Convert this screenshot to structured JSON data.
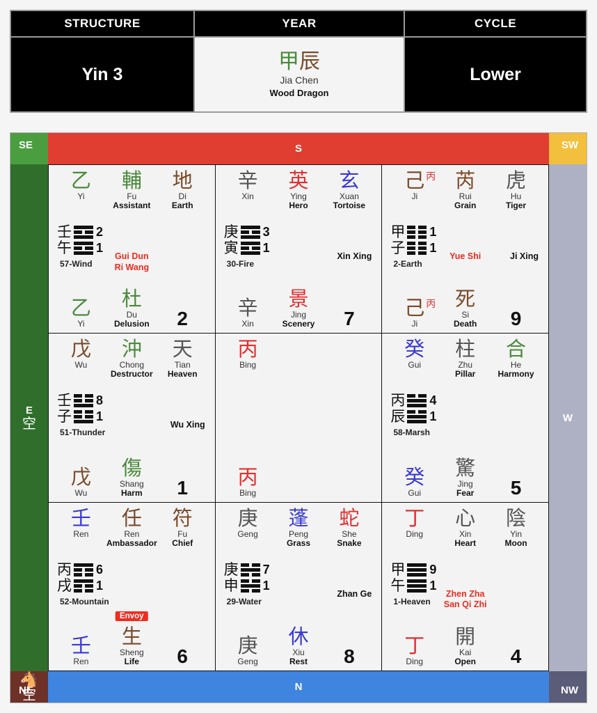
{
  "header": {
    "columns": [
      {
        "label": "STRUCTURE",
        "value": "Yin 3"
      },
      {
        "label": "YEAR",
        "value": ""
      },
      {
        "label": "CYCLE",
        "value": "Lower"
      }
    ],
    "structure_label": "STRUCTURE",
    "structure_value": "Yin 3",
    "year_label": "YEAR",
    "year_cn_1": "甲",
    "year_cn_2": "辰",
    "year_pinyin": "Jia Chen",
    "year_english": "Wood Dragon",
    "cycle_label": "CYCLE",
    "cycle_value": "Lower"
  },
  "directions": {
    "se": "SE",
    "s": "S",
    "sw": "SW",
    "e": "E",
    "w": "W",
    "ne": "NE",
    "n": "N",
    "nw": "NW",
    "e_void_cn": "空",
    "ne_void_cn": "空",
    "ne_horse_icon": "horse-icon"
  },
  "colors": {
    "se": "#4a9e3f",
    "s": "#e03e30",
    "sw": "#f2c03c",
    "e": "#2f6e2b",
    "w": "#aeb0c4",
    "ne": "#6e3128",
    "n": "#3f84de",
    "nw": "#5a5c78",
    "accent_red": "#ee2b20",
    "green": "#4a8a3c",
    "brown": "#7a4a2a",
    "blue": "#3a3ad0",
    "grey": "#555"
  },
  "palaces": [
    {
      "id": "se",
      "number": "2",
      "top": [
        {
          "cn": "乙",
          "sup": "",
          "romaji": "Yi",
          "meaning": "",
          "color": "c-green"
        },
        {
          "cn": "輔",
          "sup": "",
          "romaji": "Fu",
          "meaning": "Assistant",
          "color": "c-green"
        },
        {
          "cn": "地",
          "sup": "",
          "romaji": "Di",
          "meaning": "Earth",
          "color": "c-brown"
        }
      ],
      "hex": {
        "stem_top": "壬",
        "stem_bottom": "午",
        "num_top": "2",
        "num_bottom": "1",
        "trigram_top": [
          "solid",
          "broken",
          "solid"
        ],
        "trigram_bottom": [
          "solid",
          "broken",
          "solid"
        ],
        "name": "57-Wind"
      },
      "annot_center": {
        "lines": [
          "Gui Dun",
          "Ri Wang"
        ],
        "color": "red"
      },
      "annot_right": {
        "lines": [],
        "color": "black"
      },
      "bottom": [
        {
          "cn": "乙",
          "sup": "",
          "romaji": "Yi",
          "meaning": "",
          "color": "c-green",
          "badge": ""
        },
        {
          "cn": "杜",
          "sup": "",
          "romaji": "Du",
          "meaning": "Delusion",
          "color": "c-green",
          "badge": ""
        }
      ]
    },
    {
      "id": "s",
      "number": "7",
      "top": [
        {
          "cn": "辛",
          "sup": "",
          "romaji": "Xin",
          "meaning": "",
          "color": "c-grey"
        },
        {
          "cn": "英",
          "sup": "",
          "romaji": "Ying",
          "meaning": "Hero",
          "color": "c-red"
        },
        {
          "cn": "玄",
          "sup": "",
          "romaji": "Xuan",
          "meaning": "Tortoise",
          "color": "c-blue"
        }
      ],
      "hex": {
        "stem_top": "庚",
        "stem_bottom": "寅",
        "num_top": "3",
        "num_bottom": "1",
        "trigram_top": [
          "solid",
          "broken",
          "solid"
        ],
        "trigram_bottom": [
          "solid",
          "broken",
          "solid"
        ],
        "name": "30-Fire"
      },
      "annot_center": {
        "lines": [],
        "color": "black"
      },
      "annot_right": {
        "lines": [
          "Xin Xing"
        ],
        "color": "black"
      },
      "bottom": [
        {
          "cn": "辛",
          "sup": "",
          "romaji": "Xin",
          "meaning": "",
          "color": "c-grey",
          "badge": ""
        },
        {
          "cn": "景",
          "sup": "",
          "romaji": "Jing",
          "meaning": "Scenery",
          "color": "c-red",
          "badge": ""
        }
      ]
    },
    {
      "id": "sw",
      "number": "9",
      "top": [
        {
          "cn": "己",
          "sup": "丙",
          "romaji": "Ji",
          "meaning": "",
          "color": "c-brown"
        },
        {
          "cn": "芮",
          "sup": "",
          "romaji": "Rui",
          "meaning": "Grain",
          "color": "c-brown"
        },
        {
          "cn": "虎",
          "sup": "",
          "romaji": "Hu",
          "meaning": "Tiger",
          "color": "c-grey"
        }
      ],
      "hex": {
        "stem_top": "甲",
        "stem_bottom": "子",
        "num_top": "1",
        "num_bottom": "1",
        "trigram_top": [
          "broken",
          "broken",
          "broken"
        ],
        "trigram_bottom": [
          "broken",
          "broken",
          "broken"
        ],
        "name": "2-Earth"
      },
      "annot_center": {
        "lines": [
          "Yue Shi"
        ],
        "color": "red"
      },
      "annot_right": {
        "lines": [
          "Ji Xing"
        ],
        "color": "black"
      },
      "bottom": [
        {
          "cn": "己",
          "sup": "丙",
          "romaji": "Ji",
          "meaning": "",
          "color": "c-brown",
          "badge": ""
        },
        {
          "cn": "死",
          "sup": "",
          "romaji": "Si",
          "meaning": "Death",
          "color": "c-brown",
          "badge": ""
        }
      ]
    },
    {
      "id": "e",
      "number": "1",
      "top": [
        {
          "cn": "戊",
          "sup": "",
          "romaji": "Wu",
          "meaning": "",
          "color": "c-brown"
        },
        {
          "cn": "沖",
          "sup": "",
          "romaji": "Chong",
          "meaning": "Destructor",
          "color": "c-green"
        },
        {
          "cn": "天",
          "sup": "",
          "romaji": "Tian",
          "meaning": "Heaven",
          "color": "c-grey"
        }
      ],
      "hex": {
        "stem_top": "壬",
        "stem_bottom": "子",
        "num_top": "8",
        "num_bottom": "1",
        "trigram_top": [
          "broken",
          "broken",
          "solid"
        ],
        "trigram_bottom": [
          "broken",
          "broken",
          "solid"
        ],
        "name": "51-Thunder"
      },
      "annot_center": {
        "lines": [],
        "color": "black"
      },
      "annot_right": {
        "lines": [
          "Wu Xing"
        ],
        "color": "black"
      },
      "bottom": [
        {
          "cn": "戊",
          "sup": "",
          "romaji": "Wu",
          "meaning": "",
          "color": "c-brown",
          "badge": ""
        },
        {
          "cn": "傷",
          "sup": "",
          "romaji": "Shang",
          "meaning": "Harm",
          "color": "c-green",
          "badge": ""
        }
      ]
    },
    {
      "id": "center",
      "number": "",
      "top": [
        {
          "cn": "丙",
          "sup": "",
          "romaji": "Bing",
          "meaning": "",
          "color": "c-red"
        },
        {
          "cn": "",
          "sup": "",
          "romaji": "",
          "meaning": "",
          "color": "c-black"
        },
        {
          "cn": "",
          "sup": "",
          "romaji": "",
          "meaning": "",
          "color": "c-black"
        }
      ],
      "hex": null,
      "annot_center": {
        "lines": [],
        "color": "black"
      },
      "annot_right": {
        "lines": [],
        "color": "black"
      },
      "bottom": [
        {
          "cn": "丙",
          "sup": "",
          "romaji": "Bing",
          "meaning": "",
          "color": "c-red",
          "badge": ""
        },
        {
          "cn": "",
          "sup": "",
          "romaji": "",
          "meaning": "",
          "color": "c-black",
          "badge": ""
        }
      ]
    },
    {
      "id": "w",
      "number": "5",
      "top": [
        {
          "cn": "癸",
          "sup": "",
          "romaji": "Gui",
          "meaning": "",
          "color": "c-blue"
        },
        {
          "cn": "柱",
          "sup": "",
          "romaji": "Zhu",
          "meaning": "Pillar",
          "color": "c-grey"
        },
        {
          "cn": "合",
          "sup": "",
          "romaji": "He",
          "meaning": "Harmony",
          "color": "c-green"
        }
      ],
      "hex": {
        "stem_top": "丙",
        "stem_bottom": "辰",
        "num_top": "4",
        "num_bottom": "1",
        "trigram_top": [
          "broken",
          "solid",
          "solid"
        ],
        "trigram_bottom": [
          "broken",
          "solid",
          "solid"
        ],
        "name": "58-Marsh"
      },
      "annot_center": {
        "lines": [],
        "color": "black"
      },
      "annot_right": {
        "lines": [],
        "color": "black"
      },
      "bottom": [
        {
          "cn": "癸",
          "sup": "",
          "romaji": "Gui",
          "meaning": "",
          "color": "c-blue",
          "badge": ""
        },
        {
          "cn": "驚",
          "sup": "",
          "romaji": "Jing",
          "meaning": "Fear",
          "color": "c-grey",
          "badge": ""
        }
      ]
    },
    {
      "id": "ne",
      "number": "6",
      "top": [
        {
          "cn": "壬",
          "sup": "",
          "romaji": "Ren",
          "meaning": "",
          "color": "c-blue"
        },
        {
          "cn": "任",
          "sup": "",
          "romaji": "Ren",
          "meaning": "Ambassador",
          "color": "c-brown"
        },
        {
          "cn": "符",
          "sup": "",
          "romaji": "Fu",
          "meaning": "Chief",
          "color": "c-brown"
        }
      ],
      "hex": {
        "stem_top": "丙",
        "stem_bottom": "戌",
        "num_top": "6",
        "num_bottom": "1",
        "trigram_top": [
          "solid",
          "broken",
          "broken"
        ],
        "trigram_bottom": [
          "solid",
          "broken",
          "broken"
        ],
        "name": "52-Mountain"
      },
      "annot_center": {
        "lines": [],
        "color": "black"
      },
      "annot_right": {
        "lines": [],
        "color": "black"
      },
      "bottom": [
        {
          "cn": "壬",
          "sup": "",
          "romaji": "Ren",
          "meaning": "",
          "color": "c-blue",
          "badge": ""
        },
        {
          "cn": "生",
          "sup": "",
          "romaji": "Sheng",
          "meaning": "Life",
          "color": "c-brown",
          "badge": "Envoy"
        }
      ]
    },
    {
      "id": "n",
      "number": "8",
      "top": [
        {
          "cn": "庚",
          "sup": "",
          "romaji": "Geng",
          "meaning": "",
          "color": "c-grey"
        },
        {
          "cn": "蓬",
          "sup": "",
          "romaji": "Peng",
          "meaning": "Grass",
          "color": "c-blue"
        },
        {
          "cn": "蛇",
          "sup": "",
          "romaji": "She",
          "meaning": "Snake",
          "color": "c-red"
        }
      ],
      "hex": {
        "stem_top": "庚",
        "stem_bottom": "申",
        "num_top": "7",
        "num_bottom": "1",
        "trigram_top": [
          "broken",
          "solid",
          "broken"
        ],
        "trigram_bottom": [
          "broken",
          "solid",
          "broken"
        ],
        "name": "29-Water"
      },
      "annot_center": {
        "lines": [],
        "color": "black"
      },
      "annot_right": {
        "lines": [
          "Zhan Ge"
        ],
        "color": "black"
      },
      "bottom": [
        {
          "cn": "庚",
          "sup": "",
          "romaji": "Geng",
          "meaning": "",
          "color": "c-grey",
          "badge": ""
        },
        {
          "cn": "休",
          "sup": "",
          "romaji": "Xiu",
          "meaning": "Rest",
          "color": "c-blue",
          "badge": ""
        }
      ]
    },
    {
      "id": "nw",
      "number": "4",
      "top": [
        {
          "cn": "丁",
          "sup": "",
          "romaji": "Ding",
          "meaning": "",
          "color": "c-red"
        },
        {
          "cn": "心",
          "sup": "",
          "romaji": "Xin",
          "meaning": "Heart",
          "color": "c-grey"
        },
        {
          "cn": "陰",
          "sup": "",
          "romaji": "Yin",
          "meaning": "Moon",
          "color": "c-grey"
        }
      ],
      "hex": {
        "stem_top": "甲",
        "stem_bottom": "午",
        "num_top": "9",
        "num_bottom": "1",
        "trigram_top": [
          "solid",
          "solid",
          "solid"
        ],
        "trigram_bottom": [
          "solid",
          "solid",
          "solid"
        ],
        "name": "1-Heaven"
      },
      "annot_center": {
        "lines": [
          "Zhen Zha",
          "San Qi Zhi"
        ],
        "color": "red"
      },
      "annot_right": {
        "lines": [],
        "color": "black"
      },
      "bottom": [
        {
          "cn": "丁",
          "sup": "",
          "romaji": "Ding",
          "meaning": "",
          "color": "c-red",
          "badge": ""
        },
        {
          "cn": "開",
          "sup": "",
          "romaji": "Kai",
          "meaning": "Open",
          "color": "c-grey",
          "badge": ""
        }
      ]
    }
  ]
}
